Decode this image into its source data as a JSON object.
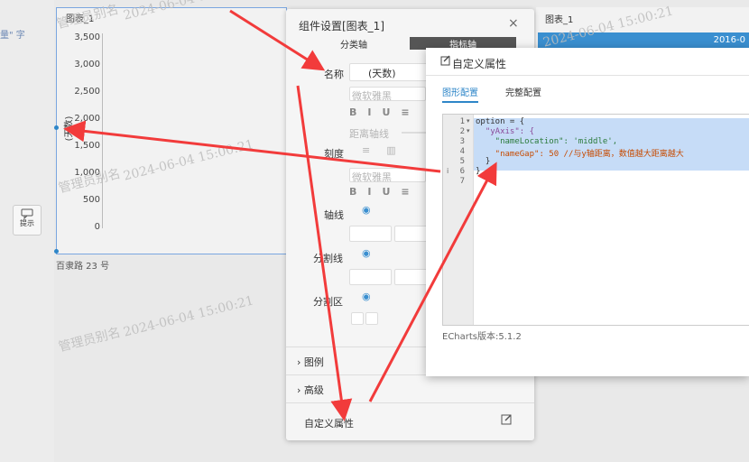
{
  "watermark": {
    "name": "管理员别名",
    "time": "2024-06-04  15:00:21"
  },
  "left_edge": {
    "fragment": "量\"  字",
    "hint_button": "提示"
  },
  "chart_left": {
    "title": "图表_1",
    "ylabel": "(天数)",
    "caption": "百隶路 23 号",
    "chart_data": {
      "type": "bar",
      "title": "",
      "xlabel": "",
      "ylabel": "(天数)",
      "ylim": [
        0,
        3500
      ],
      "yticks": [
        "3,500",
        "3,000",
        "2,500",
        "2,000",
        "1,500",
        "1,000",
        "500",
        "0"
      ],
      "categories": [],
      "values": []
    }
  },
  "chart_right": {
    "title": "图表_1",
    "date": "2016-0"
  },
  "panel": {
    "title": "组件设置[图表_1]",
    "tab_category": "分类轴",
    "tab_indicator": "指标轴",
    "name_label": "名称",
    "name_value": "(天数)",
    "font_value": "微软雅黑",
    "distance_label": "距离轴线",
    "scale_label": "刻度",
    "font_value2": "微软雅黑",
    "axis_line_label": "轴线",
    "split_line_label": "分割线",
    "split_area_label": "分割区",
    "section_legend": "图例",
    "section_advanced": "高级",
    "custom_props_label": "自定义属性"
  },
  "dialog": {
    "title": "自定义属性",
    "tab_graphic": "图形配置",
    "tab_full": "完整配置",
    "code_lines": [
      "option = {",
      "  \"yAxis\": {",
      "    \"nameLocation\": 'middle',",
      "    \"nameGap\": 50 //与y轴距离，数值越大距离越大",
      "  }",
      "}",
      ""
    ],
    "line_numbers": [
      "1",
      "2",
      "3",
      "4",
      "5",
      "6",
      "7"
    ],
    "footer": "ECharts版本:5.1.2"
  },
  "colors": {
    "arrow": "#f23b3b",
    "accent": "#2e86c8",
    "selection": "#c6dcf7"
  }
}
